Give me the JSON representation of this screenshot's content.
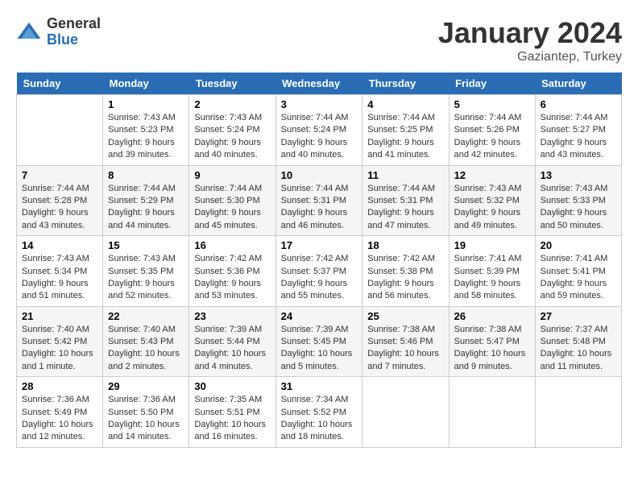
{
  "header": {
    "logo_general": "General",
    "logo_blue": "Blue",
    "month": "January 2024",
    "location": "Gaziantep, Turkey"
  },
  "weekdays": [
    "Sunday",
    "Monday",
    "Tuesday",
    "Wednesday",
    "Thursday",
    "Friday",
    "Saturday"
  ],
  "weeks": [
    [
      {
        "day": "",
        "sunrise": "",
        "sunset": "",
        "daylight": ""
      },
      {
        "day": "1",
        "sunrise": "Sunrise: 7:43 AM",
        "sunset": "Sunset: 5:23 PM",
        "daylight": "Daylight: 9 hours and 39 minutes."
      },
      {
        "day": "2",
        "sunrise": "Sunrise: 7:43 AM",
        "sunset": "Sunset: 5:24 PM",
        "daylight": "Daylight: 9 hours and 40 minutes."
      },
      {
        "day": "3",
        "sunrise": "Sunrise: 7:44 AM",
        "sunset": "Sunset: 5:24 PM",
        "daylight": "Daylight: 9 hours and 40 minutes."
      },
      {
        "day": "4",
        "sunrise": "Sunrise: 7:44 AM",
        "sunset": "Sunset: 5:25 PM",
        "daylight": "Daylight: 9 hours and 41 minutes."
      },
      {
        "day": "5",
        "sunrise": "Sunrise: 7:44 AM",
        "sunset": "Sunset: 5:26 PM",
        "daylight": "Daylight: 9 hours and 42 minutes."
      },
      {
        "day": "6",
        "sunrise": "Sunrise: 7:44 AM",
        "sunset": "Sunset: 5:27 PM",
        "daylight": "Daylight: 9 hours and 43 minutes."
      }
    ],
    [
      {
        "day": "7",
        "sunrise": "Sunrise: 7:44 AM",
        "sunset": "Sunset: 5:28 PM",
        "daylight": "Daylight: 9 hours and 43 minutes."
      },
      {
        "day": "8",
        "sunrise": "Sunrise: 7:44 AM",
        "sunset": "Sunset: 5:29 PM",
        "daylight": "Daylight: 9 hours and 44 minutes."
      },
      {
        "day": "9",
        "sunrise": "Sunrise: 7:44 AM",
        "sunset": "Sunset: 5:30 PM",
        "daylight": "Daylight: 9 hours and 45 minutes."
      },
      {
        "day": "10",
        "sunrise": "Sunrise: 7:44 AM",
        "sunset": "Sunset: 5:31 PM",
        "daylight": "Daylight: 9 hours and 46 minutes."
      },
      {
        "day": "11",
        "sunrise": "Sunrise: 7:44 AM",
        "sunset": "Sunset: 5:31 PM",
        "daylight": "Daylight: 9 hours and 47 minutes."
      },
      {
        "day": "12",
        "sunrise": "Sunrise: 7:43 AM",
        "sunset": "Sunset: 5:32 PM",
        "daylight": "Daylight: 9 hours and 49 minutes."
      },
      {
        "day": "13",
        "sunrise": "Sunrise: 7:43 AM",
        "sunset": "Sunset: 5:33 PM",
        "daylight": "Daylight: 9 hours and 50 minutes."
      }
    ],
    [
      {
        "day": "14",
        "sunrise": "Sunrise: 7:43 AM",
        "sunset": "Sunset: 5:34 PM",
        "daylight": "Daylight: 9 hours and 51 minutes."
      },
      {
        "day": "15",
        "sunrise": "Sunrise: 7:43 AM",
        "sunset": "Sunset: 5:35 PM",
        "daylight": "Daylight: 9 hours and 52 minutes."
      },
      {
        "day": "16",
        "sunrise": "Sunrise: 7:42 AM",
        "sunset": "Sunset: 5:36 PM",
        "daylight": "Daylight: 9 hours and 53 minutes."
      },
      {
        "day": "17",
        "sunrise": "Sunrise: 7:42 AM",
        "sunset": "Sunset: 5:37 PM",
        "daylight": "Daylight: 9 hours and 55 minutes."
      },
      {
        "day": "18",
        "sunrise": "Sunrise: 7:42 AM",
        "sunset": "Sunset: 5:38 PM",
        "daylight": "Daylight: 9 hours and 56 minutes."
      },
      {
        "day": "19",
        "sunrise": "Sunrise: 7:41 AM",
        "sunset": "Sunset: 5:39 PM",
        "daylight": "Daylight: 9 hours and 58 minutes."
      },
      {
        "day": "20",
        "sunrise": "Sunrise: 7:41 AM",
        "sunset": "Sunset: 5:41 PM",
        "daylight": "Daylight: 9 hours and 59 minutes."
      }
    ],
    [
      {
        "day": "21",
        "sunrise": "Sunrise: 7:40 AM",
        "sunset": "Sunset: 5:42 PM",
        "daylight": "Daylight: 10 hours and 1 minute."
      },
      {
        "day": "22",
        "sunrise": "Sunrise: 7:40 AM",
        "sunset": "Sunset: 5:43 PM",
        "daylight": "Daylight: 10 hours and 2 minutes."
      },
      {
        "day": "23",
        "sunrise": "Sunrise: 7:39 AM",
        "sunset": "Sunset: 5:44 PM",
        "daylight": "Daylight: 10 hours and 4 minutes."
      },
      {
        "day": "24",
        "sunrise": "Sunrise: 7:39 AM",
        "sunset": "Sunset: 5:45 PM",
        "daylight": "Daylight: 10 hours and 5 minutes."
      },
      {
        "day": "25",
        "sunrise": "Sunrise: 7:38 AM",
        "sunset": "Sunset: 5:46 PM",
        "daylight": "Daylight: 10 hours and 7 minutes."
      },
      {
        "day": "26",
        "sunrise": "Sunrise: 7:38 AM",
        "sunset": "Sunset: 5:47 PM",
        "daylight": "Daylight: 10 hours and 9 minutes."
      },
      {
        "day": "27",
        "sunrise": "Sunrise: 7:37 AM",
        "sunset": "Sunset: 5:48 PM",
        "daylight": "Daylight: 10 hours and 11 minutes."
      }
    ],
    [
      {
        "day": "28",
        "sunrise": "Sunrise: 7:36 AM",
        "sunset": "Sunset: 5:49 PM",
        "daylight": "Daylight: 10 hours and 12 minutes."
      },
      {
        "day": "29",
        "sunrise": "Sunrise: 7:36 AM",
        "sunset": "Sunset: 5:50 PM",
        "daylight": "Daylight: 10 hours and 14 minutes."
      },
      {
        "day": "30",
        "sunrise": "Sunrise: 7:35 AM",
        "sunset": "Sunset: 5:51 PM",
        "daylight": "Daylight: 10 hours and 16 minutes."
      },
      {
        "day": "31",
        "sunrise": "Sunrise: 7:34 AM",
        "sunset": "Sunset: 5:52 PM",
        "daylight": "Daylight: 10 hours and 18 minutes."
      },
      {
        "day": "",
        "sunrise": "",
        "sunset": "",
        "daylight": ""
      },
      {
        "day": "",
        "sunrise": "",
        "sunset": "",
        "daylight": ""
      },
      {
        "day": "",
        "sunrise": "",
        "sunset": "",
        "daylight": ""
      }
    ]
  ]
}
